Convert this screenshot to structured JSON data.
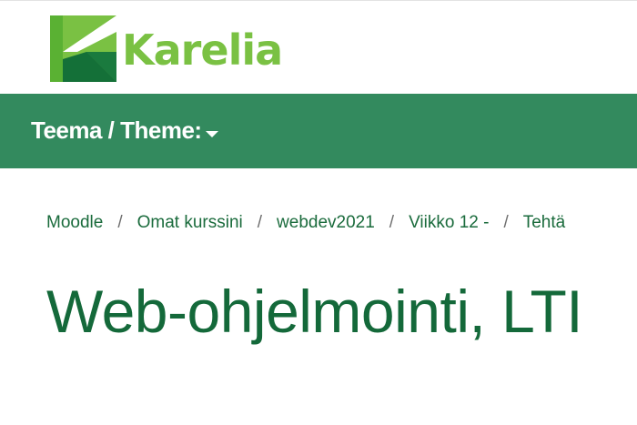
{
  "header": {
    "logo_text": "Karelia",
    "logo_icon": "karelia-k-logo-icon",
    "colors": {
      "logo_green_light": "#7ac143",
      "logo_green_dark": "#1a7a3e"
    }
  },
  "navbar": {
    "theme_label": "Teema / Theme:",
    "theme_icon": "caret-down-icon",
    "background": "#338a5e"
  },
  "breadcrumb": {
    "items": [
      "Moodle",
      "Omat kurssini",
      "webdev2021",
      "Viikko 12 -",
      "Tehtä"
    ],
    "separator": "/"
  },
  "page": {
    "title": "Web-ohjelmointi, LTI"
  }
}
